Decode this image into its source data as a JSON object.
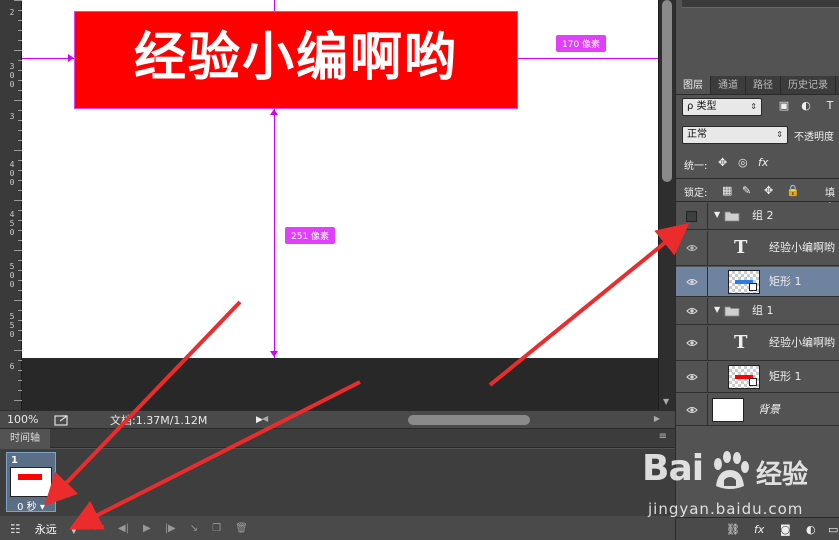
{
  "canvas": {
    "banner_text": "经验小编啊哟",
    "measure_right": "170 像素",
    "measure_down": "251 像素"
  },
  "ruler": {
    "labels": [
      "2",
      "300",
      "3",
      "400",
      "450",
      "500",
      "550",
      "6"
    ]
  },
  "status": {
    "zoom": "100%",
    "doc_info": "文档:1.37M/1.12M"
  },
  "timeline": {
    "tab": "时间轴",
    "frame_number": "1",
    "frame_delay": "0 秒",
    "loop": "永远"
  },
  "layers_panel": {
    "tabs": [
      {
        "label": "图层",
        "active": true
      },
      {
        "label": "通道",
        "active": false
      },
      {
        "label": "路径",
        "active": false
      },
      {
        "label": "历史记录",
        "active": false
      }
    ],
    "filter_kind": "ρ 类型",
    "blend_mode": "正常",
    "opacity_label": "不透明度",
    "unify_label": "统一:",
    "lock_label": "锁定:",
    "fill_label": "填充",
    "layers": [
      {
        "name": "组 2",
        "type": "group",
        "visible": false,
        "selected": false
      },
      {
        "name": "经验小编啊哟",
        "type": "text",
        "visible": true,
        "selected": false
      },
      {
        "name": "矩形 1",
        "type": "shape",
        "visible": true,
        "selected": true,
        "bar_color": "#2d7de0"
      },
      {
        "name": "组 1",
        "type": "group",
        "visible": true,
        "selected": false
      },
      {
        "name": "经验小编啊哟",
        "type": "text",
        "visible": true,
        "selected": false
      },
      {
        "name": "矩形 1",
        "type": "shape",
        "visible": true,
        "selected": false,
        "bar_color": "#ff0000"
      },
      {
        "name": "背景",
        "type": "background",
        "visible": true,
        "selected": false
      }
    ]
  },
  "watermark": {
    "brand": "Bai",
    "brand_suffix": "经验",
    "url": "jingyan.baidu.com"
  },
  "colors": {
    "banner": "#ff0000",
    "guide": "#d500f9",
    "annotation_arrow": "#ec2c2c",
    "selected_layer": "#6f83a0"
  }
}
